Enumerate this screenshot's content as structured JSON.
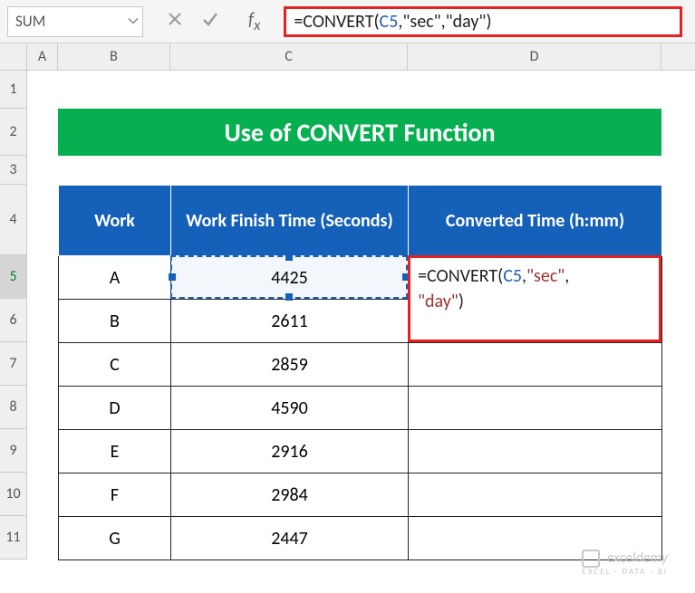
{
  "namebox": {
    "value": "SUM"
  },
  "formula_bar": {
    "prefix": "=",
    "func": "CONVERT",
    "open": "(",
    "ref": "C5",
    "sep1": ",",
    "arg2": "\"sec\"",
    "sep2": ",",
    "arg3": "\"day\"",
    "close": ")"
  },
  "columns": {
    "A": "A",
    "B": "B",
    "C": "C",
    "D": "D"
  },
  "rows": [
    "1",
    "2",
    "3",
    "4",
    "5",
    "6",
    "7",
    "8",
    "9",
    "10",
    "11"
  ],
  "title": "Use of CONVERT Function",
  "headers": {
    "work": "Work",
    "finish": "Work Finish Time (Seconds)",
    "converted": "Converted Time (h:mm)"
  },
  "data_rows": [
    {
      "work": "A",
      "seconds": "4425"
    },
    {
      "work": "B",
      "seconds": "2611"
    },
    {
      "work": "C",
      "seconds": "2859"
    },
    {
      "work": "D",
      "seconds": "4590"
    },
    {
      "work": "E",
      "seconds": "2916"
    },
    {
      "work": "F",
      "seconds": "2984"
    },
    {
      "work": "G",
      "seconds": "2447"
    }
  ],
  "inline_editor": {
    "prefix": "=",
    "func": "CONVERT",
    "open": "(",
    "ref": "C5",
    "sep1": ",",
    "arg2": "\"sec\"",
    "sep2": ",",
    "arg3": "\"day\"",
    "close": ")"
  },
  "watermark": {
    "brand": "exceldemy",
    "tagline": "EXCEL · DATA · BI"
  }
}
